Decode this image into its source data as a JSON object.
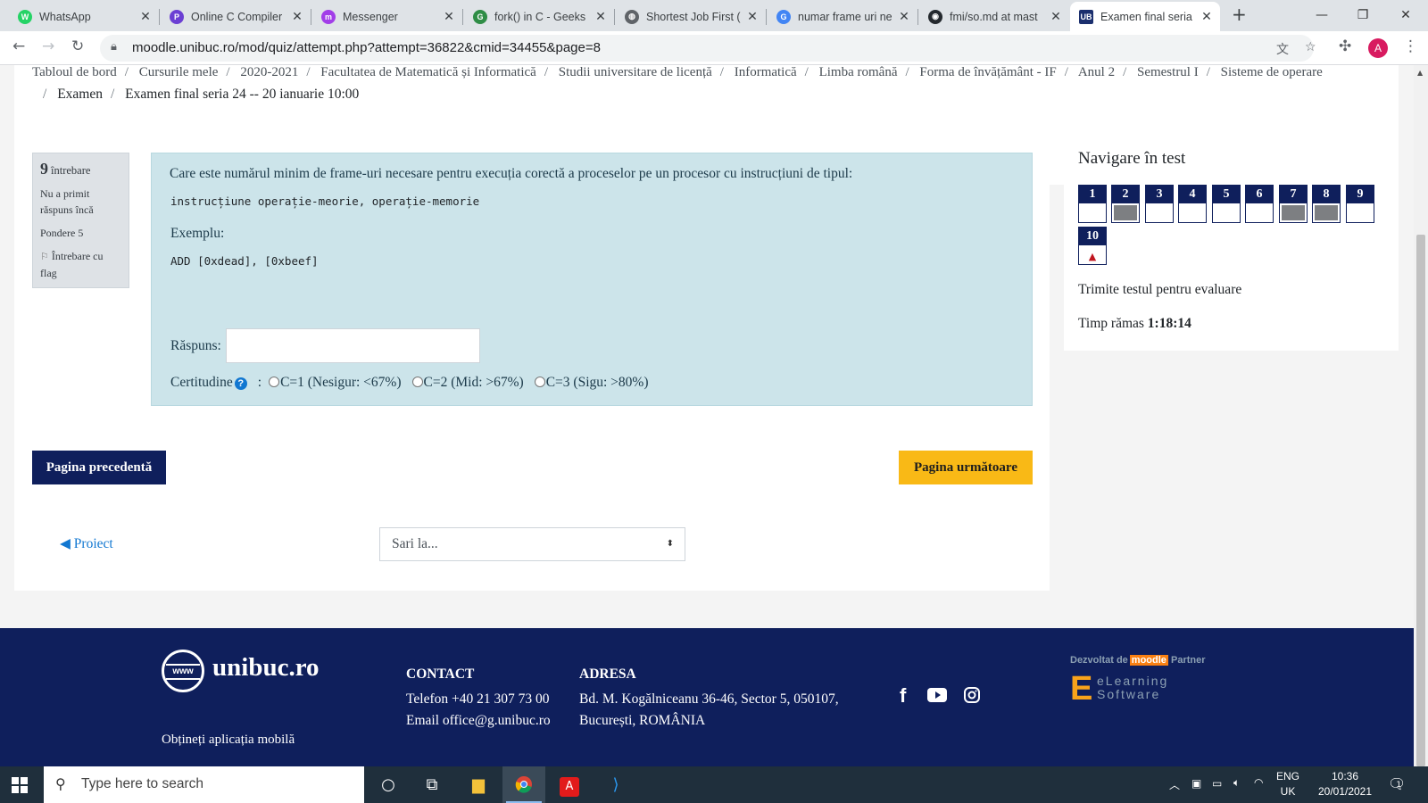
{
  "browser": {
    "tabs": [
      {
        "title": "WhatsApp",
        "fav_color": "#25d366",
        "fav_glyph": "W"
      },
      {
        "title": "Online C Compiler",
        "fav_color": "#6b3fd3",
        "fav_glyph": "P"
      },
      {
        "title": "Messenger",
        "fav_color": "#a23ee8",
        "fav_glyph": "m"
      },
      {
        "title": "fork() in C - Geeks",
        "fav_color": "#2f8d46",
        "fav_glyph": "G"
      },
      {
        "title": "Shortest Job First (",
        "fav_color": "#5f6368",
        "fav_glyph": "◍"
      },
      {
        "title": "numar frame uri ne",
        "fav_color": "#4285f4",
        "fav_glyph": "G"
      },
      {
        "title": "fmi/so.md at mast",
        "fav_color": "#24292e",
        "fav_glyph": "◉"
      },
      {
        "title": "Examen final seria",
        "fav_color": "#1b2f6e",
        "fav_glyph": "UB"
      }
    ],
    "url": "moodle.unibuc.ro/mod/quiz/attempt.php?attempt=36822&cmid=34455&page=8",
    "profile_initial": "A"
  },
  "breadcrumb": {
    "row1": [
      "Tabloul de bord",
      "Cursurile mele",
      "2020-2021",
      "Facultatea de Matematică și Informatică",
      "Studii universitare de licență",
      "Informatică",
      "Limba română",
      "Forma de învățământ - IF",
      "Anul 2",
      "Semestrul I",
      "Sisteme de operare"
    ],
    "row2": [
      "Examen",
      "Examen final seria 24 -- 20 ianuarie 10:00"
    ]
  },
  "question": {
    "number": "9",
    "number_label": "întrebare",
    "status": "Nu a primit răspuns încă",
    "weight": "Pondere 5",
    "flag_label": "Întrebare cu flag",
    "text": "Care este numărul minim de frame-uri necesare pentru execuția corectă a proceselor pe un procesor cu instrucțiuni de tipul:",
    "code": "instrucțiune operație-meorie, operație-memorie",
    "example_label": "Exemplu:",
    "example_code": "ADD [0xdead], [0xbeef]",
    "answer_label": "Răspuns:",
    "answer_value": "",
    "certainty_label": "Certitudine",
    "certainty_sep": ":",
    "certainty_options": [
      "C=1 (Nesigur: <67%)",
      "C=2 (Mid: >67%)",
      "C=3 (Sigu: >80%)"
    ]
  },
  "navigation": {
    "prev_button": "Pagina precedentă",
    "next_button": "Pagina următoare",
    "prev_link": "◀ Proiect",
    "jump_placeholder": "Sari la...",
    "jump_arrow": "⬍"
  },
  "quiz_nav": {
    "title": "Navigare în test",
    "questions": [
      {
        "label": "1",
        "answered": false
      },
      {
        "label": "2",
        "answered": true
      },
      {
        "label": "3",
        "answered": false
      },
      {
        "label": "4",
        "answered": false
      },
      {
        "label": "5",
        "answered": false
      },
      {
        "label": "6",
        "answered": false
      },
      {
        "label": "7",
        "answered": true
      },
      {
        "label": "8",
        "answered": true
      },
      {
        "label": "9",
        "answered": false
      },
      {
        "label": "10",
        "answered": false,
        "flagged": true
      }
    ],
    "submit_label": "Trimite testul pentru evaluare",
    "timer_label": "Timp rămas",
    "timer_value": "1:18:14"
  },
  "footer": {
    "logo_text": "unibuc.ro",
    "logo_www": "www",
    "mobile_app": "Obțineți aplicația mobilă",
    "contact_heading": "CONTACT",
    "contact_phone": "Telefon +40 21 307 73 00",
    "contact_email": "Email office@g.unibuc.ro",
    "address_heading": "ADRESA",
    "address_line1": "Bd. M. Kogălniceanu 36-46, Sector 5, 050107,",
    "address_line2": "București, ROMÂNIA",
    "partner_top": "Dezvoltat de",
    "partner_badge": "moodle",
    "partner_badge2": "Partner",
    "partner_name": "eLearning Software"
  },
  "taskbar": {
    "search_placeholder": "Type here to search",
    "lang_line1": "ENG",
    "lang_line2": "UK",
    "time": "10:36",
    "date": "20/01/2021",
    "notif_count": "1"
  },
  "colors": {
    "brand_navy": "#0f1f5c",
    "accent_yellow": "#f9b916",
    "question_bg": "#cce4ea",
    "link": "#1177d1"
  }
}
